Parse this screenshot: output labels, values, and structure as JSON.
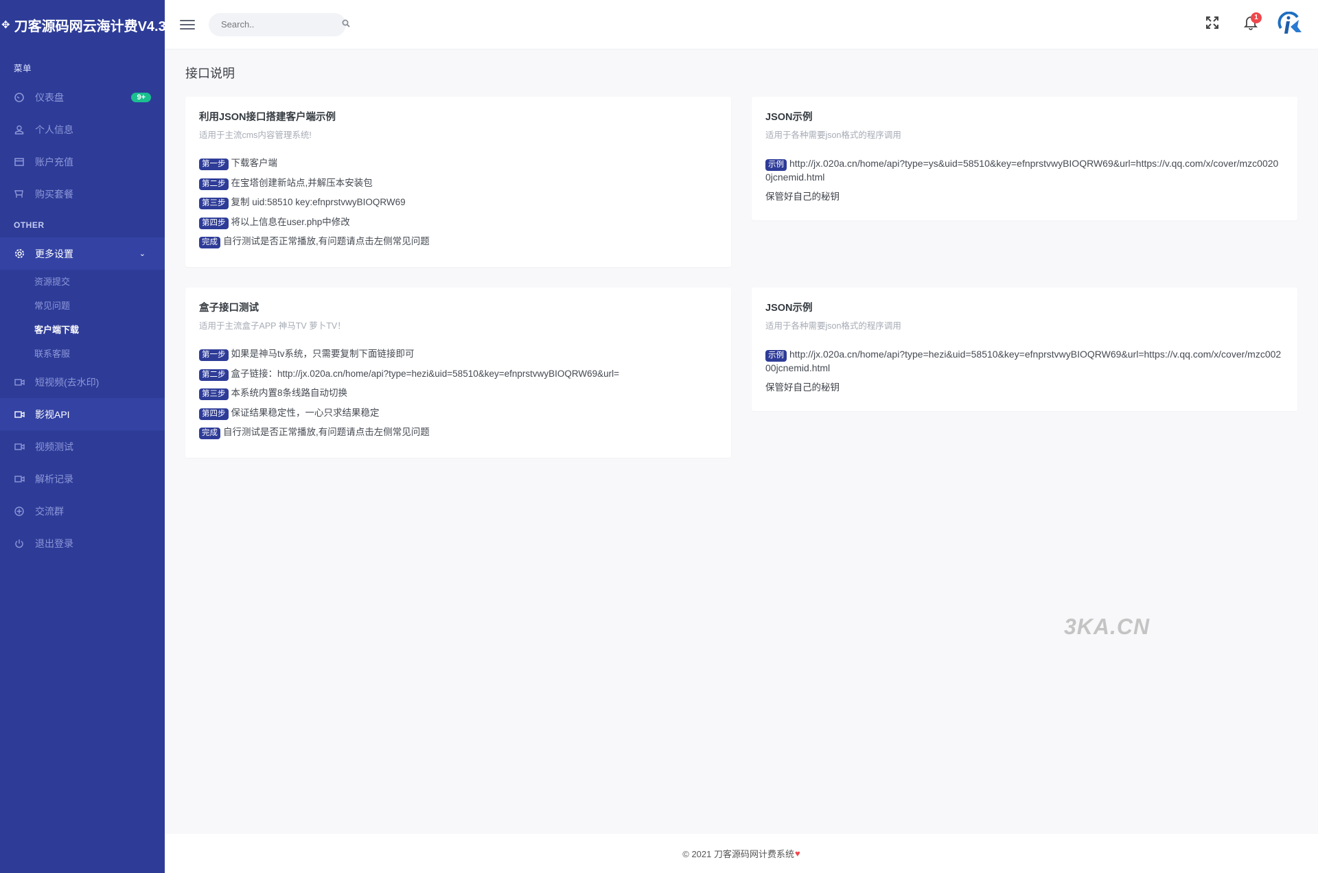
{
  "brand": {
    "title": "刀客源码网云海计费V4.3"
  },
  "sidebar": {
    "section_menu": "菜单",
    "items_top": [
      {
        "label": "仪表盘",
        "icon": "dashboard-icon",
        "badge": "9+"
      },
      {
        "label": "个人信息",
        "icon": "user-icon"
      },
      {
        "label": "账户充值",
        "icon": "credit-card-icon"
      },
      {
        "label": "购买套餐",
        "icon": "cart-icon"
      }
    ],
    "section_other": "OTHER",
    "more_settings": {
      "label": "更多设置",
      "icon": "gear-icon"
    },
    "sub_items": [
      {
        "label": "资源提交"
      },
      {
        "label": "常见问题"
      },
      {
        "label": "客户端下载"
      },
      {
        "label": "联系客服"
      }
    ],
    "items_bottom": [
      {
        "label": "短视频(去水印)",
        "icon": "video-icon"
      },
      {
        "label": "影视API",
        "icon": "video-icon"
      },
      {
        "label": "视频测试",
        "icon": "video-icon"
      },
      {
        "label": "解析记录",
        "icon": "video-icon"
      },
      {
        "label": "交流群",
        "icon": "plus-circle-icon"
      },
      {
        "label": "退出登录",
        "icon": "power-icon"
      }
    ]
  },
  "header": {
    "search_placeholder": "Search..",
    "notification_count": "1"
  },
  "page": {
    "title": "接口说明"
  },
  "cards": {
    "client": {
      "title": "利用JSON接口搭建客户端示例",
      "subtitle": "适用于主流cms内容管理系统!",
      "steps": [
        {
          "tag": "第一步",
          "text": "下载客户端"
        },
        {
          "tag": "第二步",
          "text": "在宝塔创建新站点,并解压本安装包"
        },
        {
          "tag": "第三步",
          "text": "复制 uid:58510 key:efnprstvwyBIOQRW69"
        },
        {
          "tag": "第四步",
          "text": "将以上信息在user.php中修改"
        },
        {
          "tag": "完成",
          "text": "自行测试是否正常播放,有问题请点击左侧常见问题"
        }
      ]
    },
    "json1": {
      "title": "JSON示例",
      "subtitle": "适用于各种需要json格式的程序调用",
      "tag": "示例",
      "url": "http://jx.020a.cn/home/api?type=ys&uid=58510&key=efnprstvwyBIOQRW69&url=https://v.qq.com/x/cover/mzc00200jcnemid.html",
      "note": "保管好自己的秘钥"
    },
    "box": {
      "title": "盒子接口测试",
      "subtitle": "适用于主流盒子APP 神马TV 萝卜TV！",
      "steps": [
        {
          "tag": "第一步",
          "text": "如果是神马tv系统，只需要复制下面链接即可"
        },
        {
          "tag": "第二步",
          "text": "盒子链接：http://jx.020a.cn/home/api?type=hezi&uid=58510&key=efnprstvwyBIOQRW69&url="
        },
        {
          "tag": "第三步",
          "text": "本系统内置8条线路自动切换"
        },
        {
          "tag": "第四步",
          "text": "保证结果稳定性，一心只求结果稳定"
        },
        {
          "tag": "完成",
          "text": "自行测试是否正常播放,有问题请点击左侧常见问题"
        }
      ]
    },
    "json2": {
      "title": "JSON示例",
      "subtitle": "适用于各种需要json格式的程序调用",
      "tag": "示例",
      "url": "http://jx.020a.cn/home/api?type=hezi&uid=58510&key=efnprstvwyBIOQRW69&url=https://v.qq.com/x/cover/mzc00200jcnemid.html",
      "note": "保管好自己的秘钥"
    }
  },
  "watermark": "3KA.CN",
  "footer": {
    "text": "© 2021 刀客源码网计费系统",
    "heart": "♥"
  },
  "colors": {
    "sidebar": "#2e3c98",
    "badge_green": "#1bc08f",
    "notify_red": "#f0474b"
  }
}
